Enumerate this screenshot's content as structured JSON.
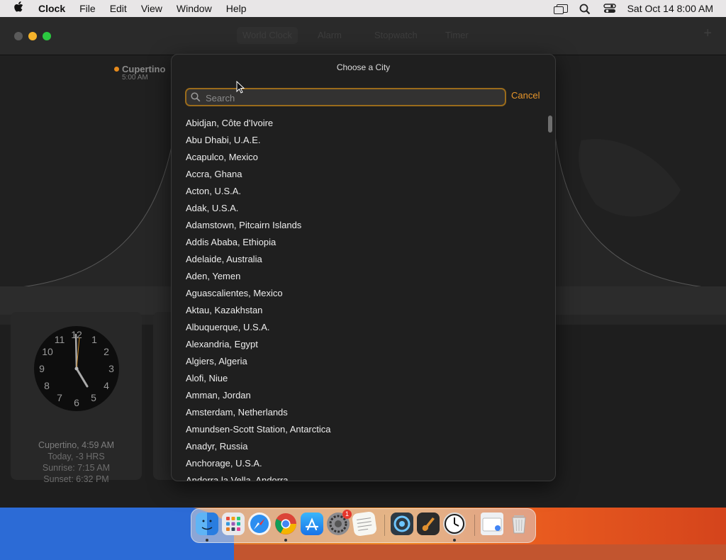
{
  "menubar": {
    "app_name": "Clock",
    "menus": [
      "File",
      "Edit",
      "View",
      "Window",
      "Help"
    ],
    "datetime": "Sat Oct 14  8:00 AM"
  },
  "toolbar": {
    "tabs": [
      "World Clock",
      "Alarm",
      "Stopwatch",
      "Timer"
    ],
    "active_tab": "World Clock",
    "add_label": "+"
  },
  "map": {
    "city_name": "Cupertino",
    "city_time": "5:00 AM"
  },
  "card": {
    "clock_numbers": [
      "12",
      "1",
      "2",
      "3",
      "4",
      "5",
      "6",
      "7",
      "8",
      "9",
      "10",
      "11"
    ],
    "line1": "Cupertino, 4:59 AM",
    "line2": "Today, -3 HRS",
    "line3": "Sunrise: 7:15 AM",
    "line4": "Sunset: 6:32 PM"
  },
  "sheet": {
    "title": "Choose a City",
    "search_placeholder": "Search",
    "cancel_label": "Cancel",
    "cities": [
      "Abidjan, Côte d'Ivoire",
      "Abu Dhabi, U.A.E.",
      "Acapulco, Mexico",
      "Accra, Ghana",
      "Acton, U.S.A.",
      "Adak, U.S.A.",
      "Adamstown, Pitcairn Islands",
      "Addis Ababa, Ethiopia",
      "Adelaide, Australia",
      "Aden, Yemen",
      "Aguascalientes, Mexico",
      "Aktau, Kazakhstan",
      "Albuquerque, U.S.A.",
      "Alexandria, Egypt",
      "Algiers, Algeria",
      "Alofi, Niue",
      "Amman, Jordan",
      "Amsterdam, Netherlands",
      "Amundsen-Scott Station, Antarctica",
      "Anadyr, Russia",
      "Anchorage, U.S.A.",
      "Andorra la Vella, Andorra"
    ]
  },
  "dock": {
    "apps": [
      "finder-icon",
      "launchpad-icon",
      "safari-icon",
      "chrome-icon",
      "app-store-icon",
      "system-settings-icon",
      "textedit-icon",
      "quicktime-icon",
      "garageband-icon",
      "clock-icon",
      "downloads-icon",
      "trash-icon"
    ],
    "settings_badge": "1"
  },
  "colors": {
    "accent": "#e8962a",
    "search_border": "#9a6b1b",
    "sheet_bg": "#1f1f1f"
  }
}
